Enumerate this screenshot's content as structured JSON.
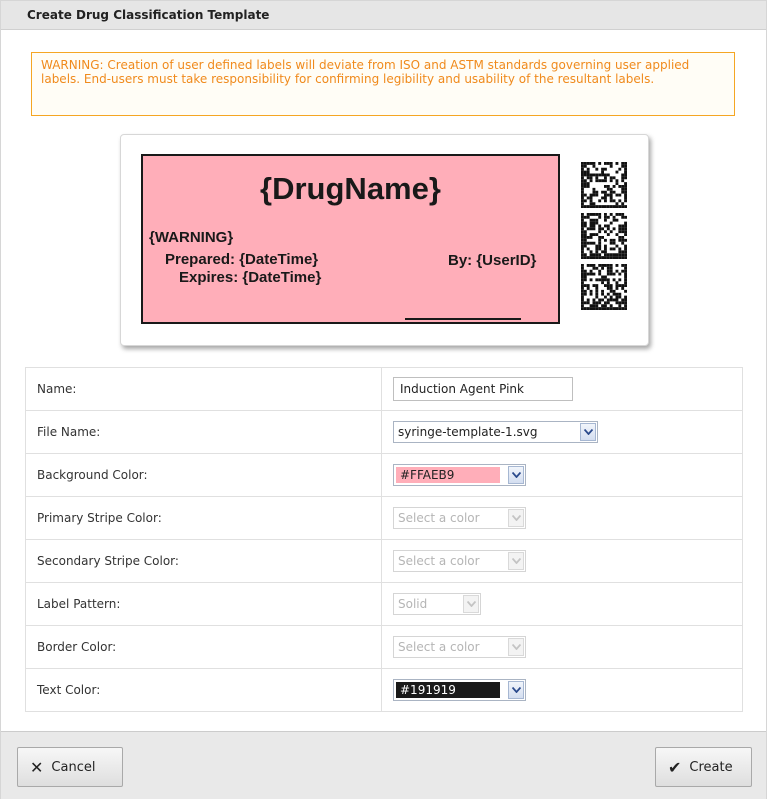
{
  "dialog": {
    "title": "Create Drug Classification Template",
    "warning": "WARNING: Creation of user defined labels will deviate from ISO and ASTM standards governing user applied labels. End-users must take responsibility for confirming legibility and usability of the resultant labels."
  },
  "preview": {
    "background_color": "#FFAEB9",
    "text_color": "#191919",
    "drug_name": "{DrugName}",
    "warning": "{WARNING}",
    "prepared": "Prepared: {DateTime}",
    "expires": "Expires: {DateTime}",
    "by": "By: {UserID}",
    "barcode_icon": "2d-barcode-icon"
  },
  "form": {
    "name_label": "Name:",
    "name_value": "Induction Agent Pink",
    "file_name_label": "File Name:",
    "file_name_value": "syringe-template-1.svg",
    "background_color_label": "Background Color:",
    "background_color_value": "#FFAEB9",
    "primary_stripe_label": "Primary Stripe Color:",
    "primary_stripe_value": "Select a color",
    "secondary_stripe_label": "Secondary Stripe Color:",
    "secondary_stripe_value": "Select a color",
    "label_pattern_label": "Label Pattern:",
    "label_pattern_value": "Solid",
    "border_color_label": "Border Color:",
    "border_color_value": "Select a color",
    "text_color_label": "Text Color:",
    "text_color_value": "#191919"
  },
  "footer": {
    "cancel_label": "Cancel",
    "cancel_icon": "close-icon",
    "create_label": "Create",
    "create_icon": "checkmark-icon"
  },
  "colors": {
    "warning_text": "#F08A1C",
    "warning_border": "#F5A623"
  }
}
